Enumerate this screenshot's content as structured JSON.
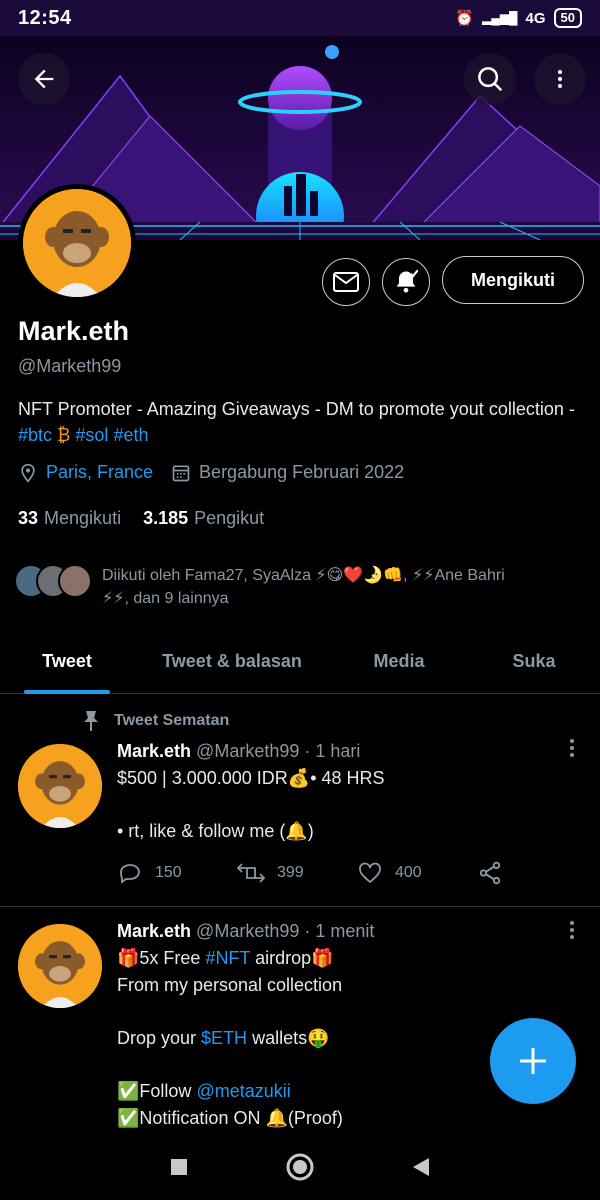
{
  "status_bar": {
    "time": "12:54",
    "network": "4G",
    "battery": "50"
  },
  "profile": {
    "name": "Mark.eth",
    "handle": "@Marketh99",
    "bio_text": "NFT Promoter - Amazing Giveaways - DM to promote yout collection - ",
    "bio_tags": [
      "#btc",
      "#sol",
      "#eth"
    ],
    "location": "Paris, France",
    "joined": "Bergabung Februari 2022",
    "following_count": "33",
    "following_label": "Mengikuti",
    "followers_count": "3.185",
    "followers_label": "Pengikut",
    "follow_button": "Mengikuti",
    "followed_by_line1": "Diikuti oleh Fama27, SyaAlza ⚡😋❤️🌛👊, ⚡⚡Ane Bahri",
    "followed_by_line2": "⚡⚡, dan 9 lainnya"
  },
  "tabs": [
    {
      "label": "Tweet",
      "active": true
    },
    {
      "label": "Tweet & balasan",
      "active": false
    },
    {
      "label": "Media",
      "active": false
    },
    {
      "label": "Suka",
      "active": false
    }
  ],
  "pinned_label": "Tweet Sematan",
  "tweets": [
    {
      "name": "Mark.eth",
      "handle": "@Marketh99",
      "time": "· 1 hari",
      "line1": "$500 | 3.000.000 IDR💰• 48 HRS",
      "line2": "• rt, like & follow me (🔔)",
      "replies": "150",
      "retweets": "399",
      "likes": "400"
    },
    {
      "name": "Mark.eth",
      "handle": "@Marketh99",
      "time": "· 1 menit",
      "l1_a": "🎁5x Free ",
      "l1_tag": "#NFT",
      "l1_b": " airdrop🎁",
      "l2": "From my personal collection",
      "l3_a": "Drop your ",
      "l3_tag": "$ETH",
      "l3_b": " wallets🤑",
      "l4_a": "✅Follow ",
      "l4_tag": "@metazukii",
      "l5": "✅Notification ON 🔔(Proof)"
    }
  ],
  "colors": {
    "accent": "#1d9bf0",
    "background": "#000000",
    "muted": "#8b98a5"
  },
  "icons": [
    "back-arrow-icon",
    "search-icon",
    "more-vertical-icon",
    "mail-icon",
    "bell-check-icon",
    "location-pin-icon",
    "calendar-icon",
    "pin-icon",
    "reply-icon",
    "retweet-icon",
    "like-icon",
    "share-icon",
    "compose-plus-icon"
  ]
}
